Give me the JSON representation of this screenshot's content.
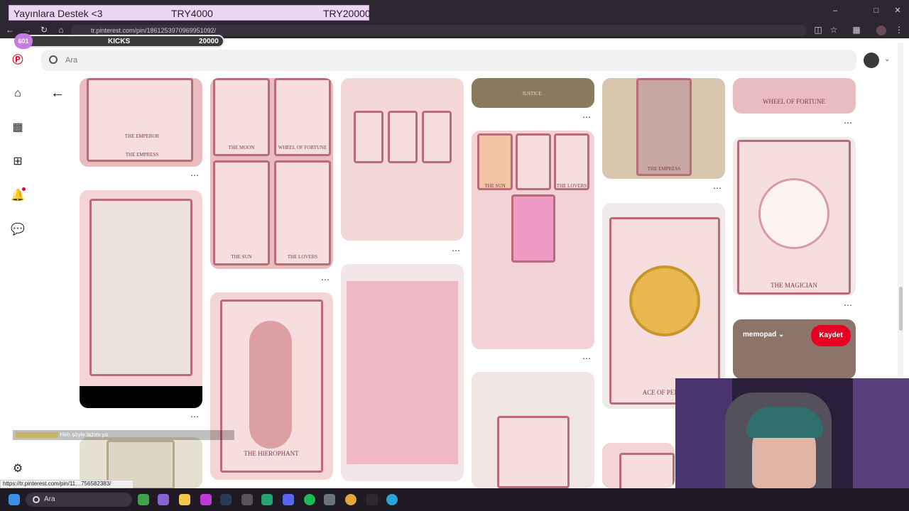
{
  "overlay": {
    "donation_title": "Yayınlara Destek <3",
    "donation_current": "TRY4000",
    "donation_goal": "TRY20000",
    "kicks_count": "601",
    "kicks_label": "KICKS",
    "kicks_goal": "20000"
  },
  "browser": {
    "url": "tr.pinterest.com/pin/1861253970969951092/"
  },
  "pinterest": {
    "search_placeholder": "Ara",
    "board_name": "memopad",
    "save_button": "Kaydet",
    "card_labels": {
      "justice": "JUSTICE",
      "wheel_of_fortune": "WHEEL OF FORTUNE",
      "the_emperor": "THE EMPEROR",
      "the_empress": "THE EMPRESS",
      "the_moon": "THE MOON",
      "wheel_small": "WHEEL OF FORTUNE",
      "the_sun": "THE SUN",
      "the_lovers": "THE LOVERS",
      "the_magician": "THE MAGICIAN",
      "ace_of_pentacles": "ACE OF PENT",
      "the_hierophant": "THE HIEROPHANT",
      "the_empress_2": "THE EMPRESS"
    }
  },
  "chat": {
    "message": "Heh şöyle lazım ya"
  },
  "status": {
    "hover_url": "https://tr.pinterest.com/pin/11…756582383/"
  },
  "taskbar": {
    "search_placeholder": "Ara"
  },
  "colors": {
    "pinterest_red": "#e60023",
    "taskbar_bg": "#1f1a24"
  }
}
